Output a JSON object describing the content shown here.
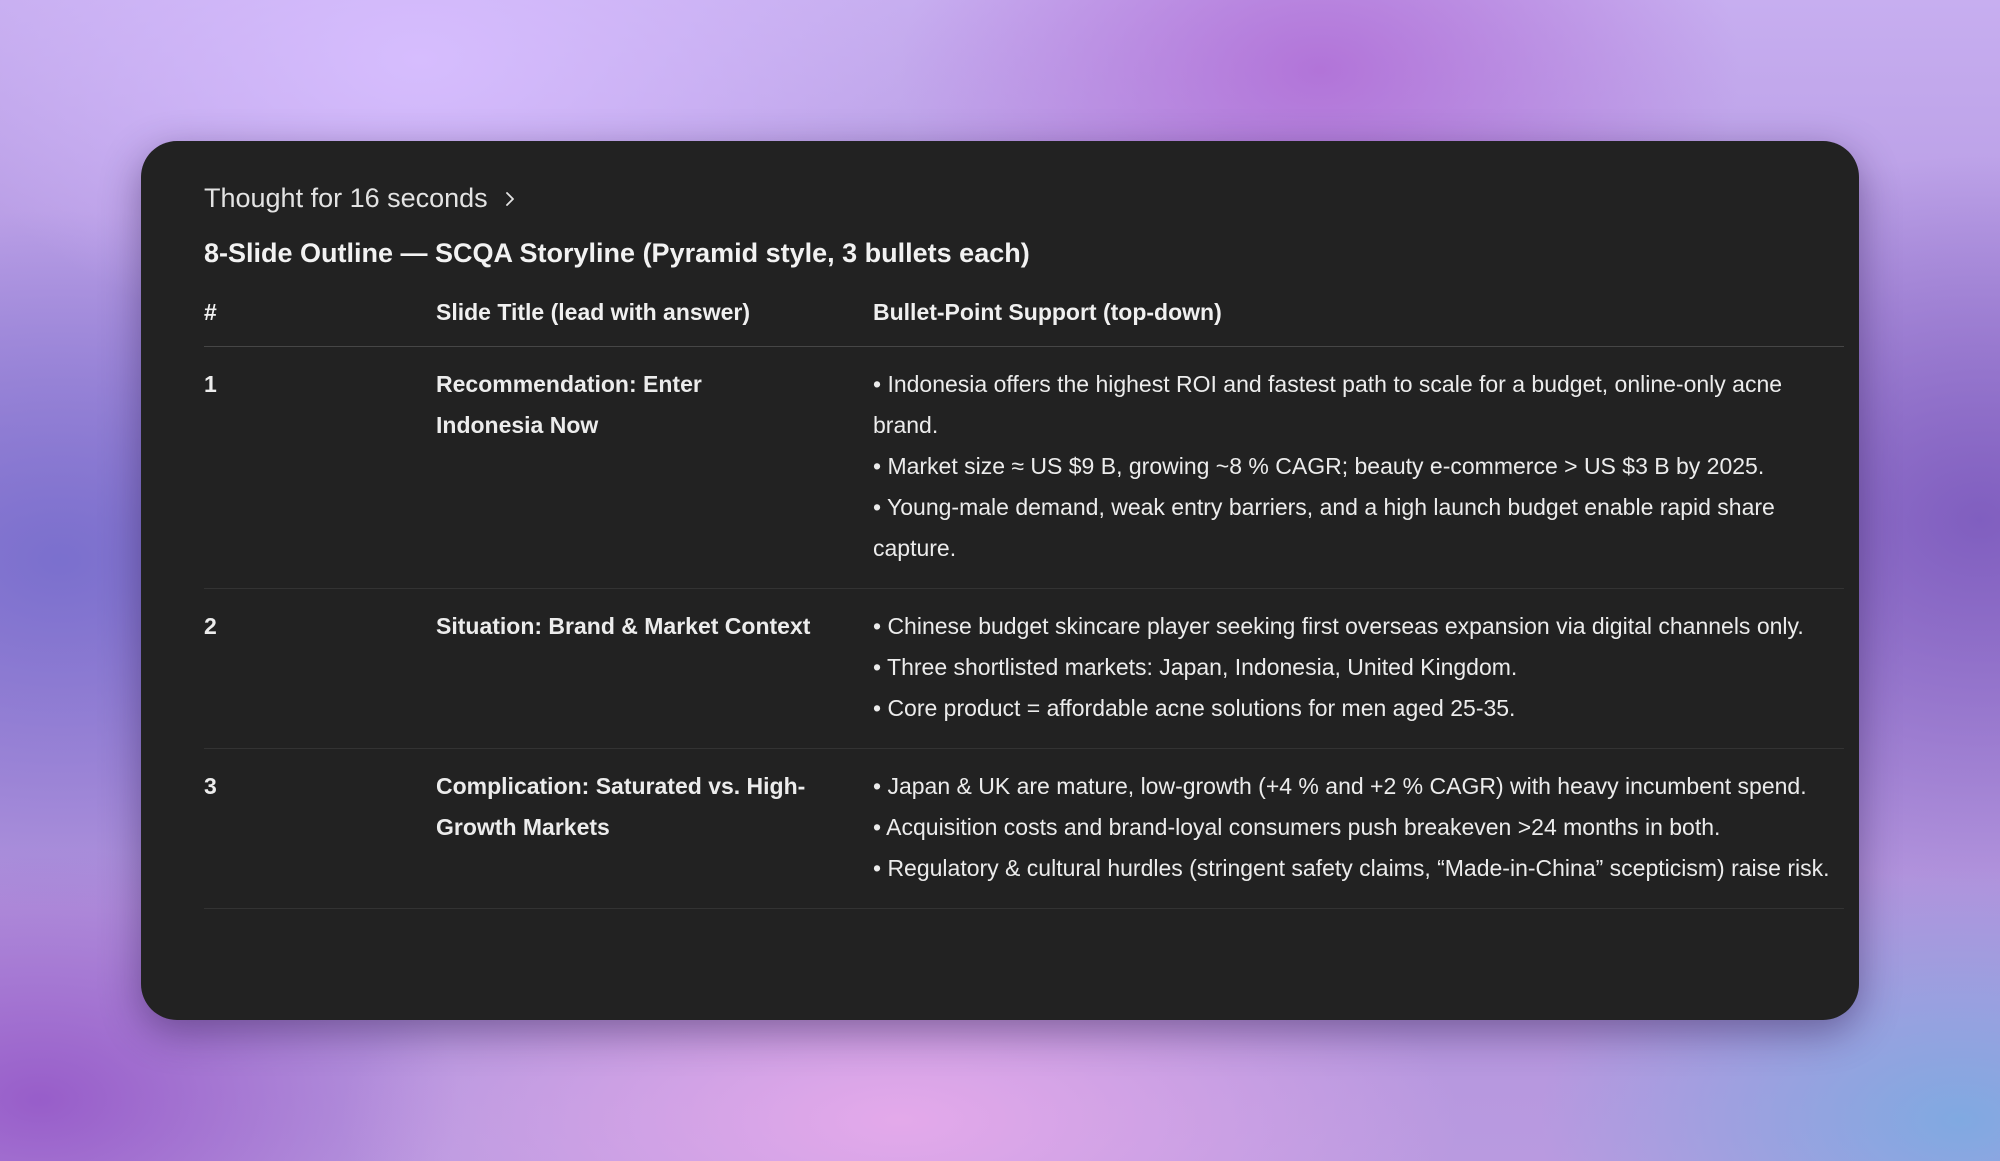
{
  "thought": {
    "label": "Thought for 16 seconds"
  },
  "heading": "8-Slide Outline — SCQA Storyline (Pyramid style, 3 bullets each)",
  "table": {
    "headers": [
      "#",
      "Slide Title (lead with answer)",
      "Bullet-Point Support (top-down)"
    ],
    "rows": [
      {
        "num": "1",
        "title": "Recommendation: Enter Indonesia Now",
        "bullets": [
          "• Indonesia offers the highest ROI and fastest path to scale for a budget, online-only acne brand.",
          "• Market size ≈ US $9 B, growing ~8 % CAGR; beauty e-commerce > US $3 B by 2025.",
          "• Young-male demand, weak entry barriers, and a high launch budget enable rapid share capture."
        ]
      },
      {
        "num": "2",
        "title": "Situation: Brand & Market Context",
        "bullets": [
          "• Chinese budget skincare player seeking first overseas expansion via digital channels only.",
          "• Three shortlisted markets: Japan, Indonesia, United Kingdom.",
          "• Core product = affordable acne solutions for men aged 25-35."
        ]
      },
      {
        "num": "3",
        "title": "Complication: Saturated vs. High-Growth Markets",
        "bullets": [
          "• Japan & UK are mature, low-growth (+4 % and +2 % CAGR) with heavy incumbent spend.",
          "• Acquisition costs and brand-loyal consumers push breakeven >24 months in both.",
          "• Regulatory & cultural hurdles (stringent safety claims, “Made-in-China” scepticism) raise risk."
        ]
      }
    ]
  },
  "colors": {
    "card_bg": "#222222",
    "text": "#ececec"
  },
  "icons": {
    "expand": "chevron-right-icon"
  }
}
